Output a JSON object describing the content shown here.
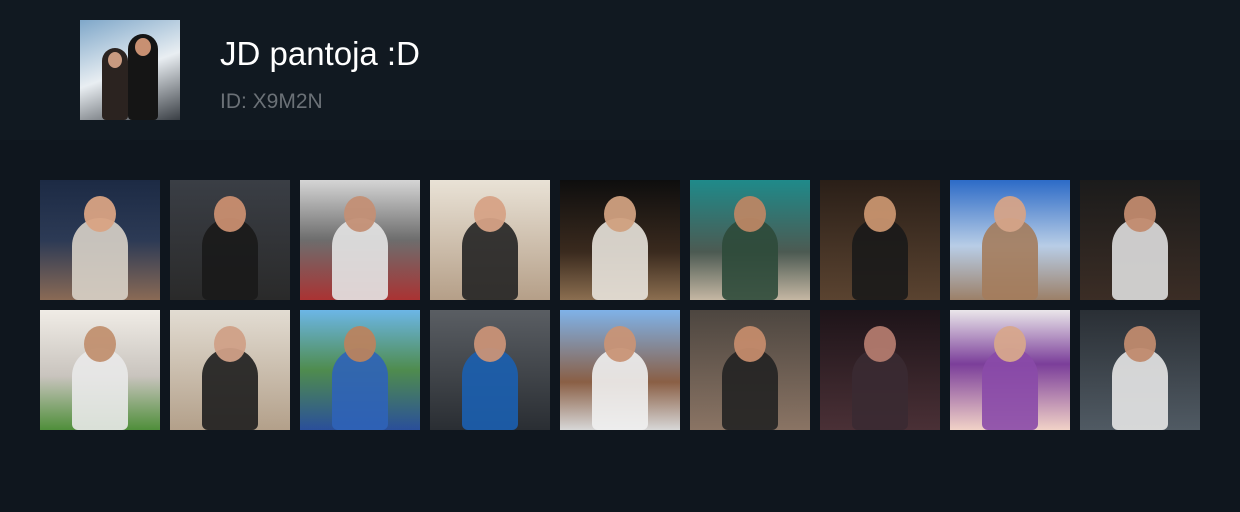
{
  "profile": {
    "name": "JD pantoja :D",
    "id_text": "ID: X9M2N"
  },
  "colors": {
    "page_background": "#0f161e",
    "header_background": "#111921",
    "title_color": "#ffffff",
    "subtitle_color": "#6b7177"
  },
  "gallery": {
    "tiles": [
      {
        "bg": "linear-gradient(180deg,#1c2a44 0%,#2c3a55 50%,#8a6a55 100%)",
        "body": "#d8d2c8",
        "head": "#d9a383"
      },
      {
        "bg": "linear-gradient(180deg,#3a3e45 0%,#2a2a2a 100%)",
        "body": "#1a1a1a",
        "head": "#c98e70"
      },
      {
        "bg": "linear-gradient(180deg,#d5d5d5 0%,#6d6d6d 50%,#a33 100%)",
        "body": "#e4e4e4",
        "head": "#c38f75"
      },
      {
        "bg": "linear-gradient(180deg,#e9e2d6 0%,#b59f88 100%)",
        "body": "#242424",
        "head": "#d6a286"
      },
      {
        "bg": "linear-gradient(180deg,#0e0e0e 0%,#3a2a1e 60%,#8b6e50 100%)",
        "body": "#e8e3dc",
        "head": "#d0a080"
      },
      {
        "bg": "linear-gradient(180deg,#1f8a8a 0%,#4c5a52 60%,#c5b7a3 100%)",
        "body": "#2e4a3a",
        "head": "#bb8664"
      },
      {
        "bg": "linear-gradient(180deg,#2a1f18 0%,#5a4330 100%)",
        "body": "#1a1a1a",
        "head": "#c8946f"
      },
      {
        "bg": "linear-gradient(180deg,#2d6bc7 0%,#b8cde6 55%,#9c8068 100%)",
        "body": "#a47c5c",
        "head": "#d5a388"
      },
      {
        "bg": "linear-gradient(180deg,#1b1b1b 0%,#3b2d25 100%)",
        "body": "#dedede",
        "head": "#c18a6e"
      },
      {
        "bg": "linear-gradient(180deg,#f0ece6 0%,#c9c4be 55%,#4f8f3a 100%)",
        "body": "#e9e9e9",
        "head": "#c19070"
      },
      {
        "bg": "linear-gradient(180deg,#e2dcd2 0%,#b3a08a 100%)",
        "body": "#1e1e1e",
        "head": "#d0a087"
      },
      {
        "bg": "linear-gradient(180deg,#6cb6e6 0%,#4f8c4e 50%,#2a4f9a 100%)",
        "body": "#2f63b8",
        "head": "#b9835f"
      },
      {
        "bg": "linear-gradient(180deg,#5a5e63 0%,#2a2e33 100%)",
        "body": "#1b5fb0",
        "head": "#c99277"
      },
      {
        "bg": "linear-gradient(180deg,#7fb2e8 0%,#8a5f45 60%,#d7d7d7 100%)",
        "body": "#efefef",
        "head": "#c89476"
      },
      {
        "bg": "linear-gradient(180deg,#4d4640 0%,#8a7464 100%)",
        "body": "#222",
        "head": "#c48b6b"
      },
      {
        "bg": "linear-gradient(180deg,#1e1419 0%,#4a3036 100%)",
        "body": "#3a2a32",
        "head": "#b27a6e"
      },
      {
        "bg": "linear-gradient(180deg,#eae6ea 0%,#7b3e9a 45%,#f1d2c7 100%)",
        "body": "#8a4aa8",
        "head": "#d7a78c"
      },
      {
        "bg": "linear-gradient(180deg,#2a2f35 0%,#505a63 100%)",
        "body": "#e6e6e6",
        "head": "#c08a6e"
      }
    ]
  }
}
